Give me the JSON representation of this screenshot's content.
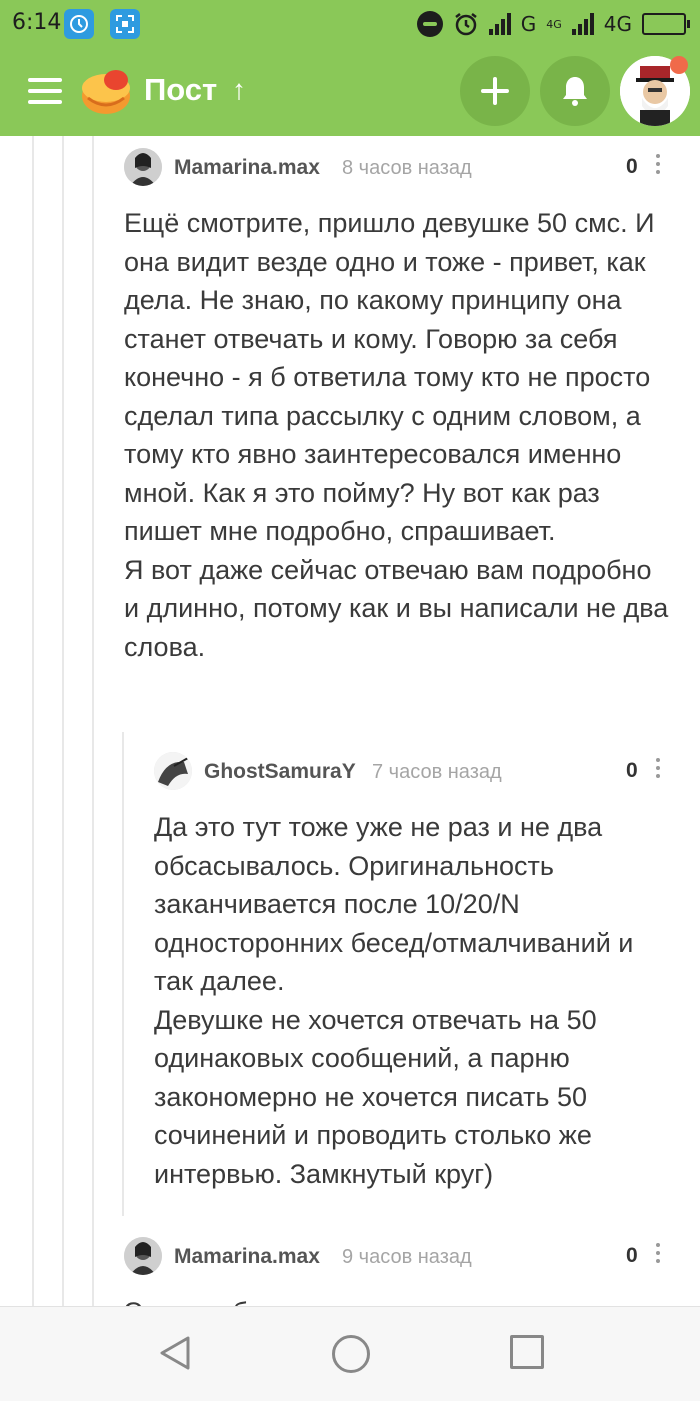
{
  "status_bar": {
    "time": "6:14",
    "network_label_1": "G",
    "network_small_label": "4G",
    "network_label_2": "4G"
  },
  "app_bar": {
    "title": "Пост",
    "up_arrow": "↑"
  },
  "comments": [
    {
      "author": "Mamarina.max",
      "time": "8 часов назад",
      "rating": "0",
      "text": "Ещё смотрите, пришло девушке 50 смс. И она видит везде одно и тоже - привет, как дела. Не знаю, по какому принципу она станет отвечать и кому. Говорю за себя конечно - я б ответила тому кто не просто сделал типа рассылку с одним словом, а тому кто явно заинтересовался именно мной. Как я это пойму? Ну вот как раз пишет мне подробно, спрашивает.\nЯ вот даже сейчас отвечаю вам подробно и длинно, потому как и вы написали не два слова."
    },
    {
      "author": "GhostSamuraY",
      "time": "7 часов назад",
      "rating": "0",
      "text": "Да это тут тоже уже не раз и не два обсасывалось. Оригинальность заканчивается после 10/20/N односторонних бесед/отмалчиваний и так далее.\nДевушке не хочется отвечать на 50 одинаковых сообщений, а парню закономерно не хочется писать 50 сочинений и проводить столько же интервью. Замкнутый круг)"
    },
    {
      "author": "Mamarina.max",
      "time": "9 часов назад",
      "rating": "0",
      "text": "Это уже больше похоже на отсутствие"
    }
  ],
  "colors": {
    "app_bar": "#8ac858",
    "app_bar_button": "#79b449",
    "notification_dot": "#f06a4a"
  },
  "icons": {
    "menu": "hamburger-icon",
    "logo": "pikabu-logo",
    "add": "plus-icon",
    "notifications": "bell-icon",
    "more": "more-vertical-icon",
    "nav_back": "triangle-back-icon",
    "nav_home": "circle-home-icon",
    "nav_recent": "square-recents-icon"
  }
}
